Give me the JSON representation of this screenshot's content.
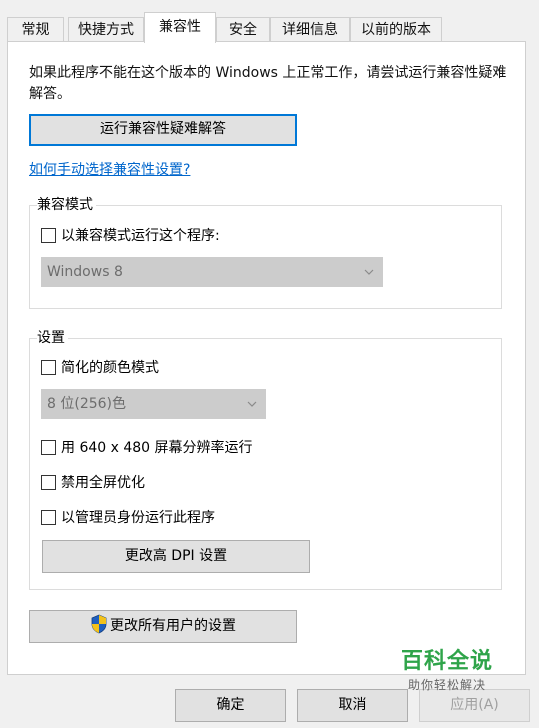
{
  "tabs": [
    {
      "label": "常规"
    },
    {
      "label": "快捷方式"
    },
    {
      "label": "兼容性"
    },
    {
      "label": "安全"
    },
    {
      "label": "详细信息"
    },
    {
      "label": "以前的版本"
    }
  ],
  "active_tab": "兼容性",
  "description": "如果此程序不能在这个版本的 Windows 上正常工作，请尝试运行兼容性疑难解答。",
  "troubleshooter_button": "运行兼容性疑难解答",
  "manual_link": "如何手动选择兼容性设置?",
  "compat_mode": {
    "title": "兼容模式",
    "checkbox_label": "以兼容模式运行这个程序:",
    "checked": false,
    "os_select": "Windows 8"
  },
  "settings": {
    "title": "设置",
    "reduced_color": {
      "label": "简化的颜色模式",
      "checked": false
    },
    "color_select": "8 位(256)色",
    "resolution": {
      "label": "用 640 x 480 屏幕分辨率运行",
      "checked": false
    },
    "fullscreen_opt": {
      "label": "禁用全屏优化",
      "checked": false
    },
    "run_as_admin": {
      "label": "以管理员身份运行此程序",
      "checked": false
    },
    "dpi_button": "更改高 DPI 设置"
  },
  "all_users_button": "更改所有用户的设置",
  "footer": {
    "ok": "确定",
    "cancel": "取消",
    "apply": "应用(A)"
  },
  "watermark": {
    "main": "百科全说",
    "sub": "助你轻松解决"
  },
  "colors": {
    "accent": "#0078d7",
    "link": "#0066cc",
    "watermark_green": "#2fa44a"
  }
}
